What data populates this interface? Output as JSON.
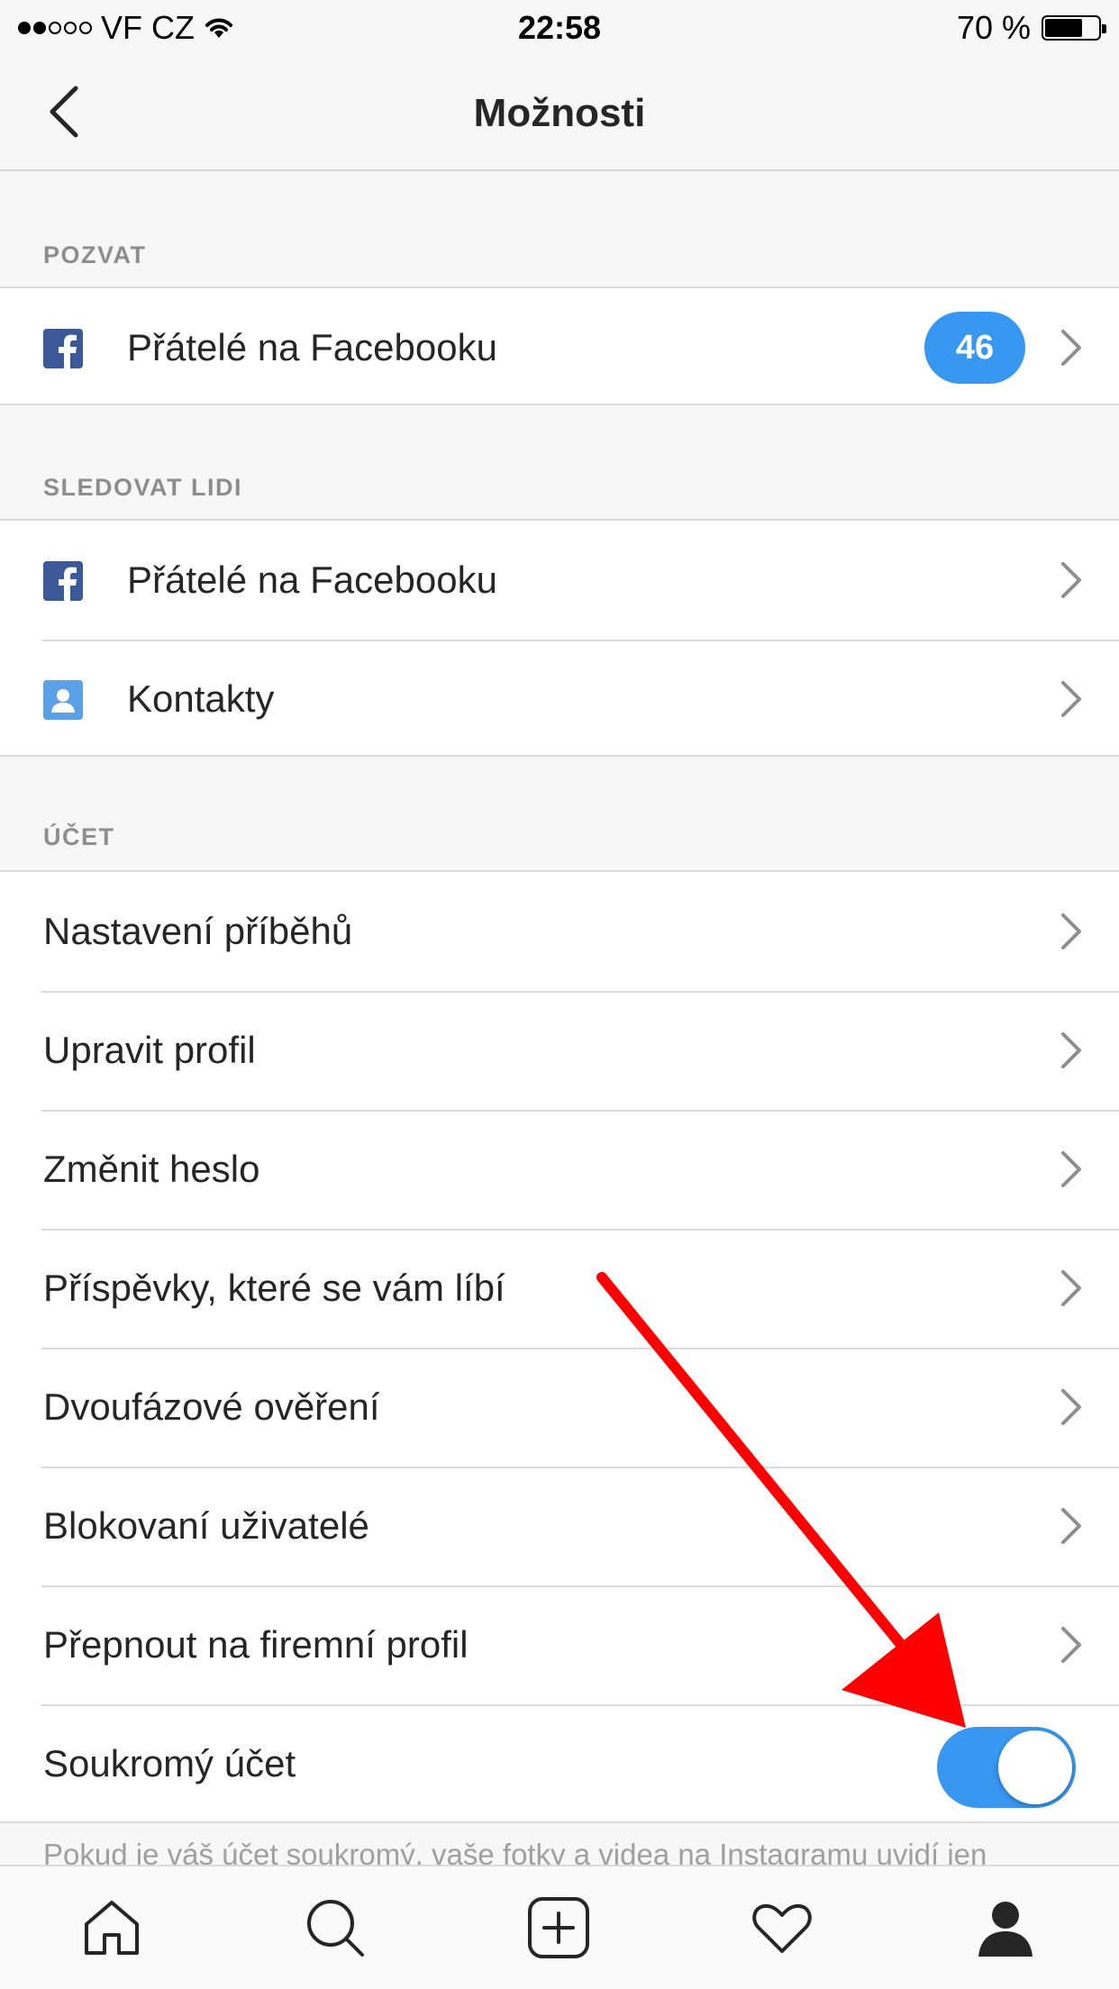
{
  "status_bar": {
    "carrier": "VF CZ",
    "time": "22:58",
    "battery": "70 %",
    "battery_level": 0.7,
    "signal_dots_filled": 2,
    "signal_dots_total": 5
  },
  "nav": {
    "title": "Možnosti",
    "back_icon": "chevron-left-icon"
  },
  "sections": {
    "invite": {
      "header": "POZVAT",
      "items": [
        {
          "label": "Přátelé na Facebooku",
          "icon": "facebook-icon",
          "badge": "46"
        }
      ]
    },
    "follow": {
      "header": "SLEDOVAT LIDI",
      "items": [
        {
          "label": "Přátelé na Facebooku",
          "icon": "facebook-icon"
        },
        {
          "label": "Kontakty",
          "icon": "contact-icon"
        }
      ]
    },
    "account": {
      "header": "ÚČET",
      "items": [
        {
          "label": "Nastavení příběhů"
        },
        {
          "label": "Upravit profil"
        },
        {
          "label": "Změnit heslo"
        },
        {
          "label": "Příspěvky, které se vám líbí"
        },
        {
          "label": "Dvoufázové ověření"
        },
        {
          "label": "Blokovaní uživatelé"
        },
        {
          "label": "Přepnout na firemní profil"
        }
      ],
      "toggle": {
        "label": "Soukromý účet",
        "on": true
      }
    }
  },
  "footer_text": "Pokud je váš účet soukromý, vaše fotky a videa na Instagramu uvidí jen",
  "tab_bar": [
    "home-icon",
    "search-icon",
    "add-icon",
    "heart-icon",
    "profile-icon"
  ],
  "colors": {
    "accent": "#3897f0",
    "facebook": "#3b5998",
    "annotation_arrow": "#ff0000"
  }
}
